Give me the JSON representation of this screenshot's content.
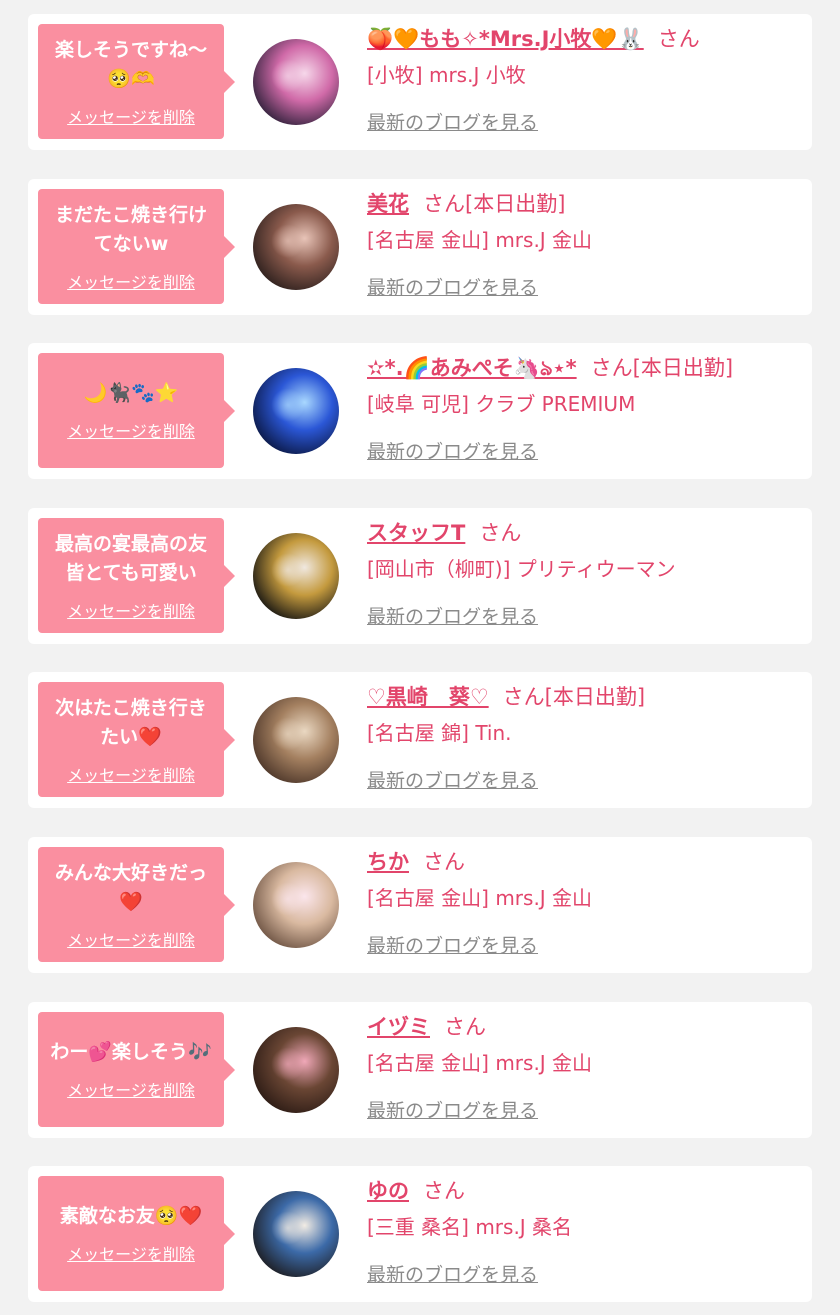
{
  "delete_label": "メッセージを削除",
  "blog_label": "最新のブログを見る",
  "colors": {
    "bubble": "#fa8fa0",
    "accent": "#e2456b",
    "muted": "#8a8a8a",
    "card": "#ffffff",
    "page": "#f2f2f2"
  },
  "items": [
    {
      "message": "楽しそうですね〜🥺🫶",
      "name": "🍑🧡もも✧*Mrs.J小牧🧡🐰",
      "suffix": "さん",
      "shop": "[小牧] mrs.J 小牧",
      "avatar_colors": [
        "#2b1f38",
        "#d06aa8",
        "#f6d8ea"
      ]
    },
    {
      "message": "まだたこ焼き行けてないw",
      "name": "美花",
      "suffix": "さん[本日出勤]",
      "shop": "[名古屋 金山] mrs.J 金山",
      "avatar_colors": [
        "#2a1e1c",
        "#8a5a4c",
        "#e8c4b8"
      ]
    },
    {
      "message": "🌙🐈‍⬛🐾⭐",
      "name": "✫*.🌈あみぺそ🦄ঌ⋆*",
      "suffix": "さん[本日出勤]",
      "shop": "[岐阜 可児] クラブ PREMIUM",
      "avatar_colors": [
        "#0a1640",
        "#2b57d6",
        "#a9d8ff"
      ]
    },
    {
      "message": "最高の宴最高の友皆とても可愛い",
      "name": "スタッフT",
      "suffix": "さん",
      "shop": "[岡山市（柳町)] プリティウーマン",
      "avatar_colors": [
        "#111111",
        "#c49a3e",
        "#f0e8e0"
      ]
    },
    {
      "message": "次はたこ焼き行きたい❤️",
      "name": "♡黒崎　葵♡",
      "suffix": "さん[本日出勤]",
      "shop": "[名古屋 錦] Tin.",
      "avatar_colors": [
        "#4a3428",
        "#a48060",
        "#ead8c2"
      ]
    },
    {
      "message": "みんな大好きだっ❤️",
      "name": "ちか",
      "suffix": "さん",
      "shop": "[名古屋 金山] mrs.J 金山",
      "avatar_colors": [
        "#6a5040",
        "#d9b9a0",
        "#fbe6ec"
      ]
    },
    {
      "message": "わー💕楽しそう🎶",
      "name": "イヅミ",
      "suffix": "さん",
      "shop": "[名古屋 金山] mrs.J 金山",
      "avatar_colors": [
        "#2a1a14",
        "#6a4634",
        "#f0a8b8"
      ]
    },
    {
      "message": "素敵なお友🥺❤️",
      "name": "ゆの",
      "suffix": "さん",
      "shop": "[三重 桑名] mrs.J 桑名",
      "avatar_colors": [
        "#1c1a1c",
        "#3c6aa8",
        "#f2ece4"
      ]
    }
  ]
}
